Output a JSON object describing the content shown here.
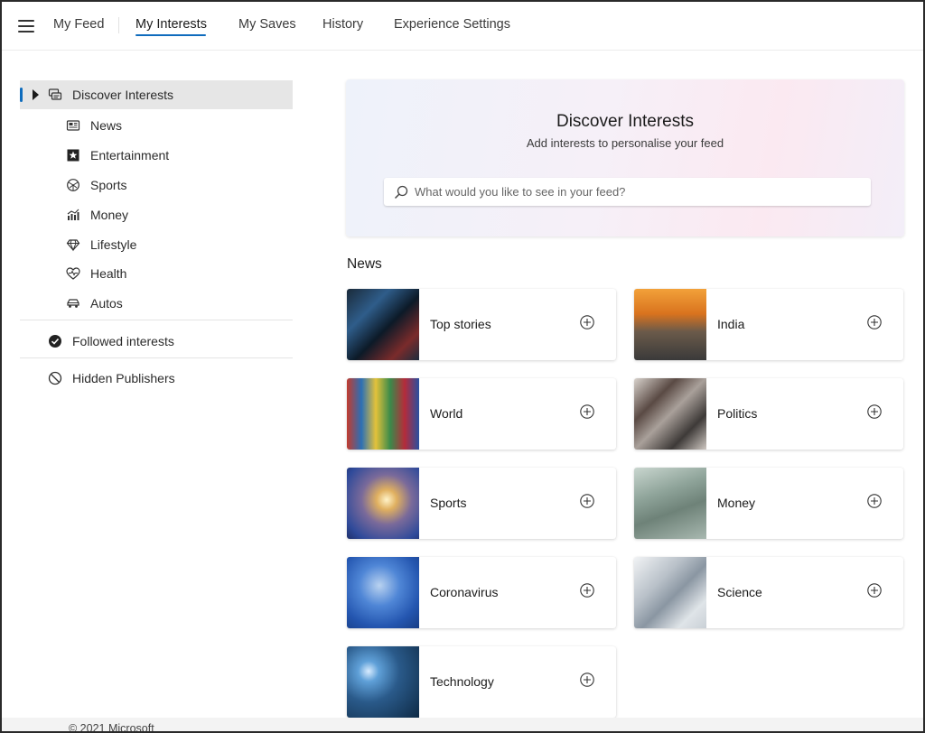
{
  "nav": {
    "tabs": [
      {
        "label": "My Feed"
      },
      {
        "label": "My Interests"
      },
      {
        "label": "My Saves"
      },
      {
        "label": "History"
      },
      {
        "label": "Experience Settings"
      }
    ]
  },
  "sidebar": {
    "discover": {
      "label": "Discover Interests",
      "icon": "discover-interests-icon"
    },
    "categories": [
      {
        "label": "News",
        "icon": "newspaper-icon"
      },
      {
        "label": "Entertainment",
        "icon": "star-icon"
      },
      {
        "label": "Sports",
        "icon": "ball-icon"
      },
      {
        "label": "Money",
        "icon": "chart-icon"
      },
      {
        "label": "Lifestyle",
        "icon": "diamond-icon"
      },
      {
        "label": "Health",
        "icon": "heart-pulse-icon"
      },
      {
        "label": "Autos",
        "icon": "car-icon"
      }
    ],
    "followed": {
      "label": "Followed interests",
      "icon": "checkmark-circle-icon"
    },
    "hidden": {
      "label": "Hidden Publishers",
      "icon": "block-icon"
    }
  },
  "hero": {
    "title": "Discover Interests",
    "subtitle": "Add interests to personalise your feed",
    "search_placeholder": "What would you like to see in your feed?"
  },
  "section": {
    "heading": "News"
  },
  "cards": [
    {
      "label": "Top stories"
    },
    {
      "label": "India"
    },
    {
      "label": "World"
    },
    {
      "label": "Politics"
    },
    {
      "label": "Sports"
    },
    {
      "label": "Money"
    },
    {
      "label": "Coronavirus"
    },
    {
      "label": "Science"
    },
    {
      "label": "Technology"
    }
  ],
  "footer": {
    "copyright": "© 2021 Microsoft"
  },
  "colors": {
    "accent": "#0f6cbd",
    "active_bg": "#e6e6e6"
  }
}
